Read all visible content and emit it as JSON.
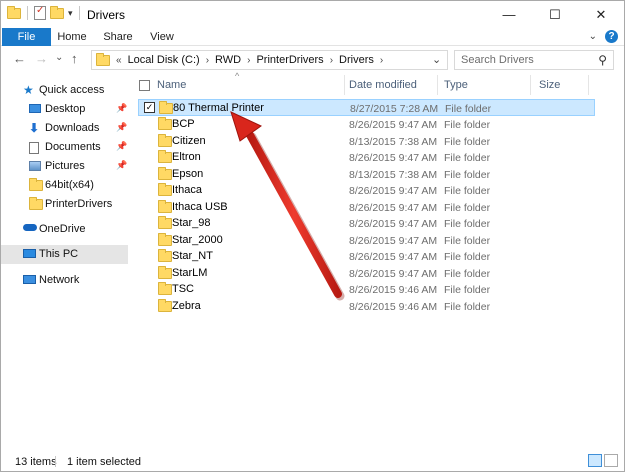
{
  "window": {
    "title": "Drivers",
    "controls": {
      "minimize": "—",
      "maximize": "☐",
      "close": "✕"
    }
  },
  "ribbon": {
    "tabs": [
      "File",
      "Home",
      "Share",
      "View"
    ],
    "expand_icon": "chevron-down-icon",
    "help_icon": "?"
  },
  "nav": {
    "back": "←",
    "forward": "→",
    "recent": "⌄",
    "up": "↑",
    "breadcrumb": [
      "Local Disk (C:)",
      "RWD",
      "PrinterDrivers",
      "Drivers"
    ],
    "breadcrumb_prefix": "«",
    "search_placeholder": "Search Drivers"
  },
  "navpane": {
    "items": [
      {
        "label": "Quick access",
        "icon": "star-icon",
        "pinned": false
      },
      {
        "label": "Desktop",
        "icon": "desktop-icon",
        "pinned": true
      },
      {
        "label": "Downloads",
        "icon": "downloads-icon",
        "pinned": true
      },
      {
        "label": "Documents",
        "icon": "documents-icon",
        "pinned": true
      },
      {
        "label": "Pictures",
        "icon": "pictures-icon",
        "pinned": true
      },
      {
        "label": "64bit(x64)",
        "icon": "folder-icon",
        "pinned": false
      },
      {
        "label": "PrinterDrivers",
        "icon": "folder-icon",
        "pinned": false
      },
      {
        "label": "OneDrive",
        "icon": "onedrive-icon",
        "pinned": false
      },
      {
        "label": "This PC",
        "icon": "this-pc-icon",
        "pinned": false
      },
      {
        "label": "Network",
        "icon": "network-icon",
        "pinned": false
      }
    ]
  },
  "columns": {
    "name": "Name",
    "date": "Date modified",
    "type": "Type",
    "size": "Size"
  },
  "files": [
    {
      "name": "80 Thermal Printer",
      "date": "8/27/2015 7:28 AM",
      "type": "File folder",
      "selected": true
    },
    {
      "name": "BCP",
      "date": "8/26/2015 9:47 AM",
      "type": "File folder"
    },
    {
      "name": "Citizen",
      "date": "8/13/2015 7:38 AM",
      "type": "File folder"
    },
    {
      "name": "Eltron",
      "date": "8/26/2015 9:47 AM",
      "type": "File folder"
    },
    {
      "name": "Epson",
      "date": "8/13/2015 7:38 AM",
      "type": "File folder"
    },
    {
      "name": "Ithaca",
      "date": "8/26/2015 9:47 AM",
      "type": "File folder"
    },
    {
      "name": "Ithaca USB",
      "date": "8/26/2015 9:47 AM",
      "type": "File folder"
    },
    {
      "name": "Star_98",
      "date": "8/26/2015 9:47 AM",
      "type": "File folder"
    },
    {
      "name": "Star_2000",
      "date": "8/26/2015 9:47 AM",
      "type": "File folder"
    },
    {
      "name": "Star_NT",
      "date": "8/26/2015 9:47 AM",
      "type": "File folder"
    },
    {
      "name": "StarLM",
      "date": "8/26/2015 9:47 AM",
      "type": "File folder"
    },
    {
      "name": "TSC",
      "date": "8/26/2015 9:46 AM",
      "type": "File folder"
    },
    {
      "name": "Zebra",
      "date": "8/26/2015 9:46 AM",
      "type": "File folder"
    }
  ],
  "status": {
    "item_count": "13 items",
    "selection": "1 item selected"
  },
  "annotation": {
    "arrow_color": "#d9261c",
    "arrow_icon": "red-arrow-annotation"
  },
  "colors": {
    "accent": "#1979ca",
    "selection_bg": "#cce8ff",
    "selection_border": "#99d1ff"
  }
}
